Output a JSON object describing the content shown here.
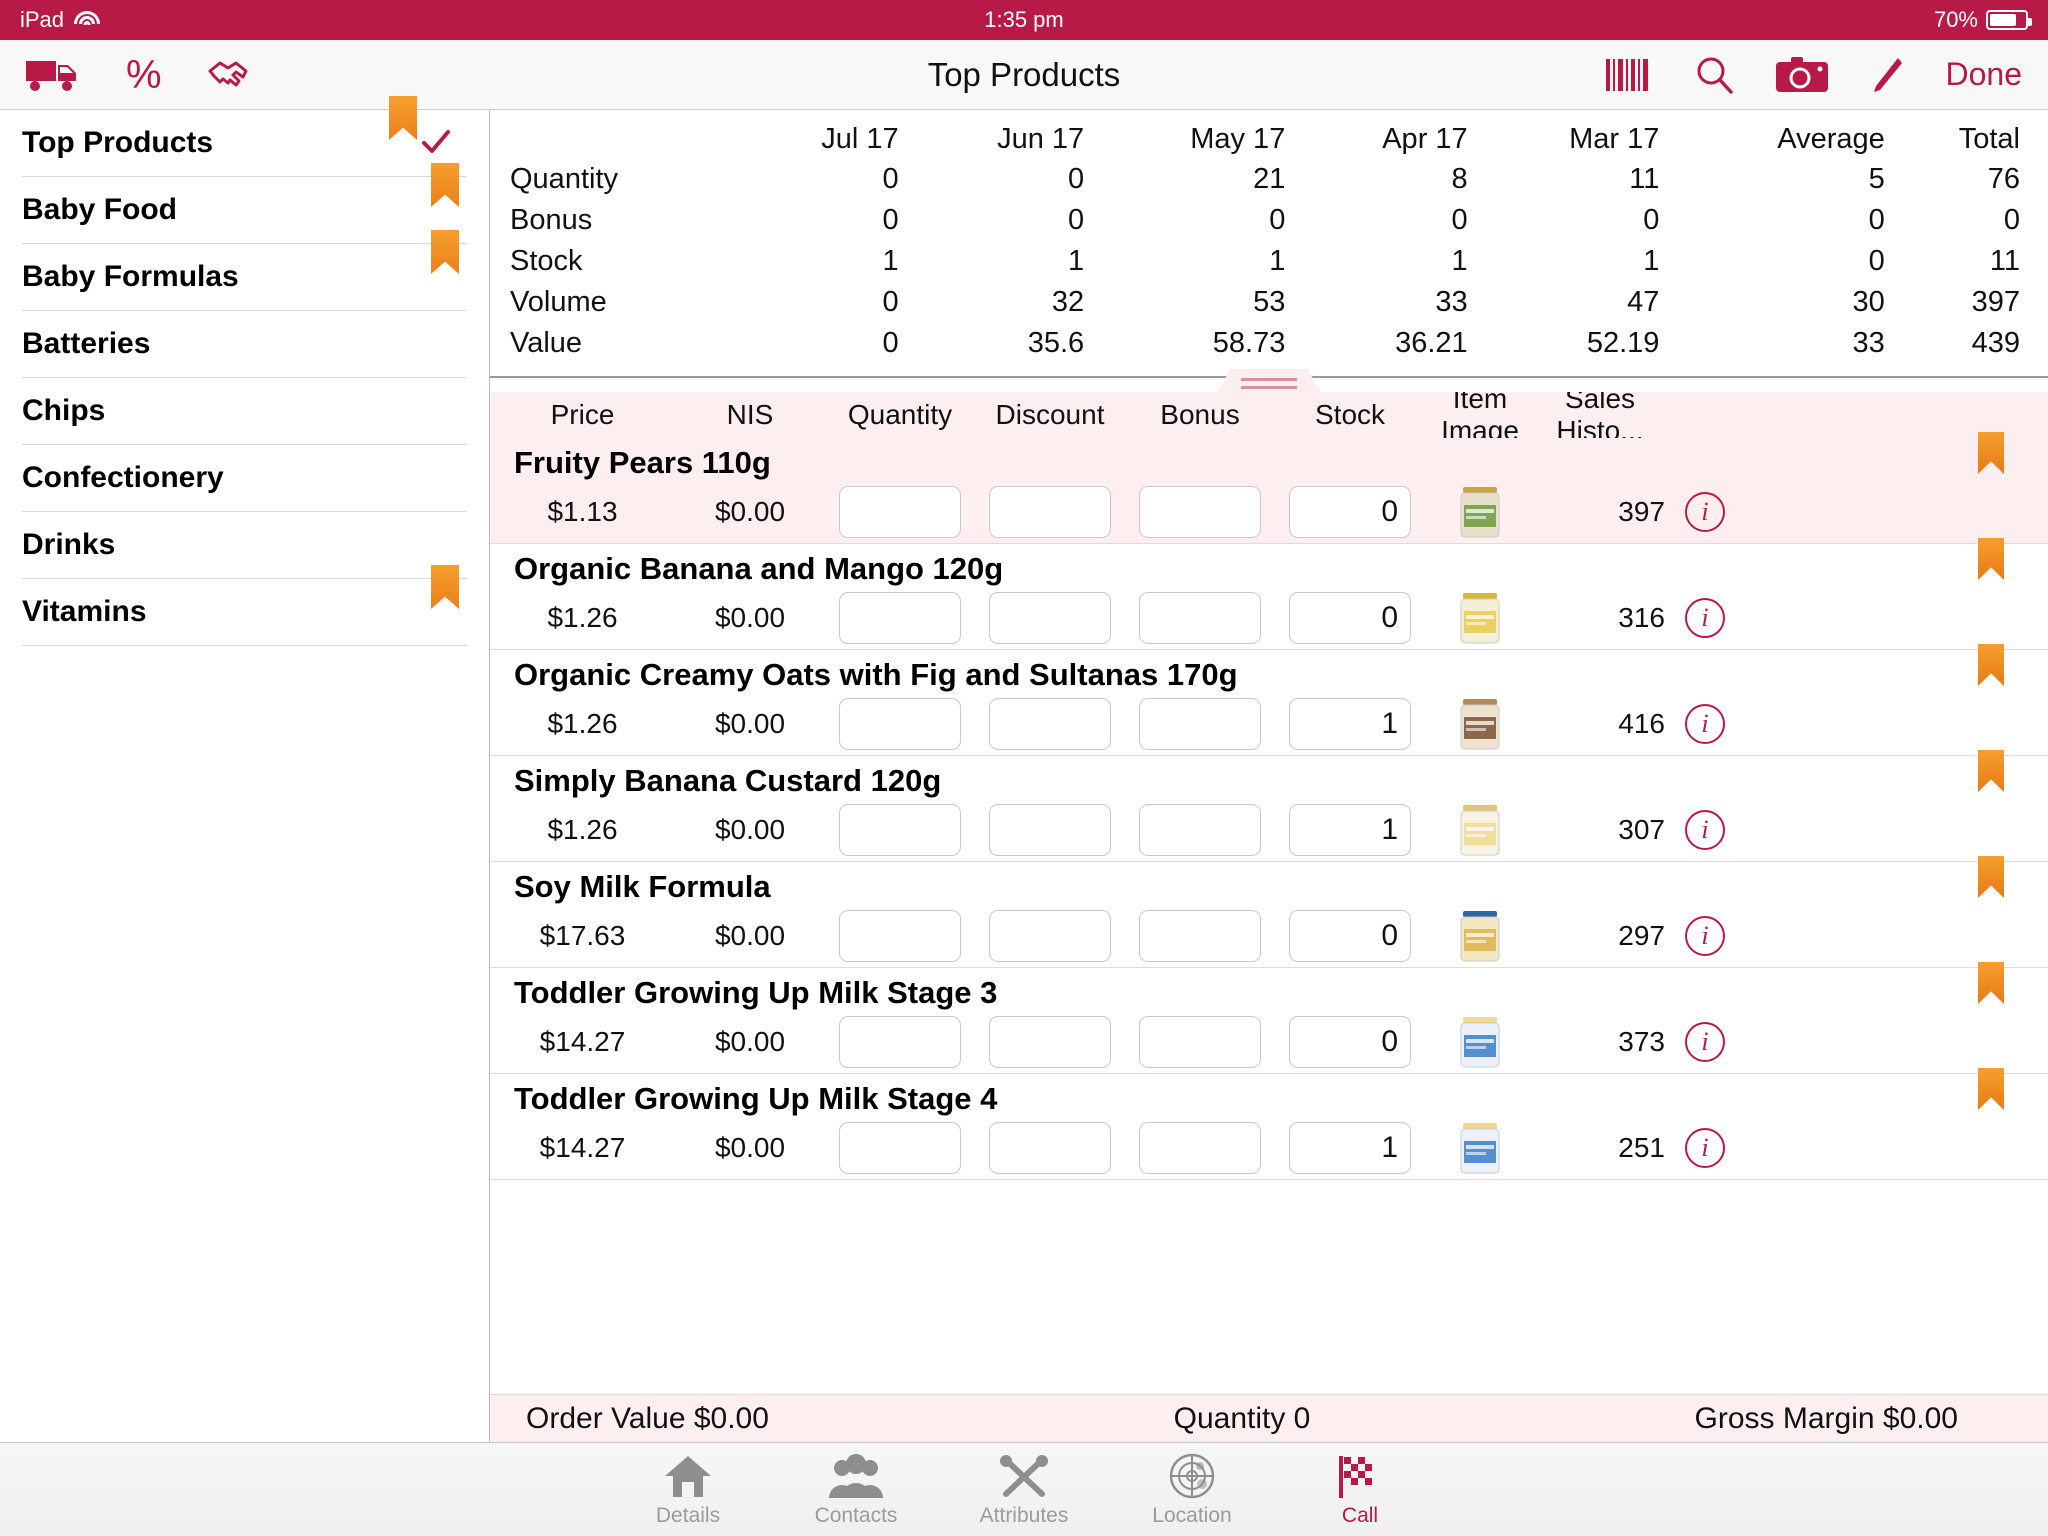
{
  "statusbar": {
    "device": "iPad",
    "time": "1:35 pm",
    "battery": "70%",
    "wifi_icon": "wifi-icon",
    "battery_icon": "battery-icon"
  },
  "navbar": {
    "title": "Top Products",
    "left_icons": [
      {
        "name": "truck-icon",
        "label": "Delivery"
      },
      {
        "name": "percent-icon",
        "label": "%"
      },
      {
        "name": "handshake-icon",
        "label": "Deals"
      }
    ],
    "right_icons": [
      {
        "name": "barcode-icon",
        "label": "Barcode"
      },
      {
        "name": "search-icon",
        "label": "Search"
      },
      {
        "name": "camera-icon",
        "label": "Camera"
      },
      {
        "name": "pencil-icon",
        "label": "Edit"
      }
    ],
    "done_label": "Done"
  },
  "sidebar": {
    "items": [
      {
        "label": "Top Products",
        "flagged": true,
        "checked": true
      },
      {
        "label": "Baby Food",
        "flagged": true,
        "checked": false
      },
      {
        "label": "Baby Formulas",
        "flagged": true,
        "checked": false
      },
      {
        "label": "Batteries",
        "flagged": false,
        "checked": false
      },
      {
        "label": "Chips",
        "flagged": false,
        "checked": false
      },
      {
        "label": "Confectionery",
        "flagged": false,
        "checked": false
      },
      {
        "label": "Drinks",
        "flagged": false,
        "checked": false
      },
      {
        "label": "Vitamins",
        "flagged": true,
        "checked": false
      }
    ]
  },
  "summary": {
    "columns": [
      "Jul 17",
      "Jun 17",
      "May 17",
      "Apr 17",
      "Mar 17",
      "Average",
      "Total"
    ],
    "rows": [
      {
        "label": "Quantity",
        "values": [
          "0",
          "0",
          "21",
          "8",
          "11",
          "5",
          "76"
        ]
      },
      {
        "label": "Bonus",
        "values": [
          "0",
          "0",
          "0",
          "0",
          "0",
          "0",
          "0"
        ]
      },
      {
        "label": "Stock",
        "values": [
          "1",
          "1",
          "1",
          "1",
          "1",
          "0",
          "11"
        ]
      },
      {
        "label": "Volume",
        "values": [
          "0",
          "32",
          "53",
          "33",
          "47",
          "30",
          "397"
        ]
      },
      {
        "label": "Value",
        "values": [
          "0",
          "35.6",
          "58.73",
          "36.21",
          "52.19",
          "33",
          "439"
        ]
      }
    ]
  },
  "product_table": {
    "headers": [
      "Price",
      "NIS",
      "Quantity",
      "Discount",
      "Bonus",
      "Stock",
      "Item Image",
      "Sales Histo..."
    ],
    "rows": [
      {
        "name": "Fruity Pears 110g",
        "price": "$1.13",
        "nis": "$0.00",
        "quantity": "",
        "discount": "",
        "bonus": "",
        "stock": "0",
        "sales_history": "397",
        "image": "baby-food-jar-green",
        "flagged": true,
        "highlighted": true
      },
      {
        "name": "Organic Banana and Mango 120g",
        "price": "$1.26",
        "nis": "$0.00",
        "quantity": "",
        "discount": "",
        "bonus": "",
        "stock": "0",
        "sales_history": "316",
        "image": "pouch-yellow",
        "flagged": true,
        "highlighted": false
      },
      {
        "name": "Organic Creamy Oats with Fig and Sultanas 170g",
        "price": "$1.26",
        "nis": "$0.00",
        "quantity": "",
        "discount": "",
        "bonus": "",
        "stock": "1",
        "sales_history": "416",
        "image": "jar-brown",
        "flagged": true,
        "highlighted": false
      },
      {
        "name": "Simply Banana Custard 120g",
        "price": "$1.26",
        "nis": "$0.00",
        "quantity": "",
        "discount": "",
        "bonus": "",
        "stock": "1",
        "sales_history": "307",
        "image": "pouch-cream",
        "flagged": true,
        "highlighted": false
      },
      {
        "name": "Soy Milk Formula",
        "price": "$17.63",
        "nis": "$0.00",
        "quantity": "",
        "discount": "",
        "bonus": "",
        "stock": "0",
        "sales_history": "297",
        "image": "formula-tin-gold",
        "flagged": true,
        "highlighted": false
      },
      {
        "name": "Toddler Growing Up Milk Stage 3",
        "price": "$14.27",
        "nis": "$0.00",
        "quantity": "",
        "discount": "",
        "bonus": "",
        "stock": "0",
        "sales_history": "373",
        "image": "formula-tin-blue",
        "flagged": true,
        "highlighted": false
      },
      {
        "name": "Toddler Growing Up Milk Stage 4",
        "price": "$14.27",
        "nis": "$0.00",
        "quantity": "",
        "discount": "",
        "bonus": "",
        "stock": "1",
        "sales_history": "251",
        "image": "formula-tin-blue2",
        "flagged": true,
        "highlighted": false
      }
    ]
  },
  "totals": {
    "order_value": "Order Value $0.00",
    "quantity": "Quantity 0",
    "gross_margin": "Gross Margin $0.00"
  },
  "tabbar": {
    "tabs": [
      {
        "label": "Details",
        "icon": "home-icon",
        "active": false
      },
      {
        "label": "Contacts",
        "icon": "people-icon",
        "active": false
      },
      {
        "label": "Attributes",
        "icon": "tools-icon",
        "active": false
      },
      {
        "label": "Location",
        "icon": "radar-icon",
        "active": false
      },
      {
        "label": "Call",
        "icon": "checkered-flag-icon",
        "active": true
      }
    ]
  },
  "colors": {
    "brand": "#b81a47",
    "status_bar": "#b81a47",
    "row_highlight": "#fdeeef",
    "flag": "#ef8a1f"
  }
}
